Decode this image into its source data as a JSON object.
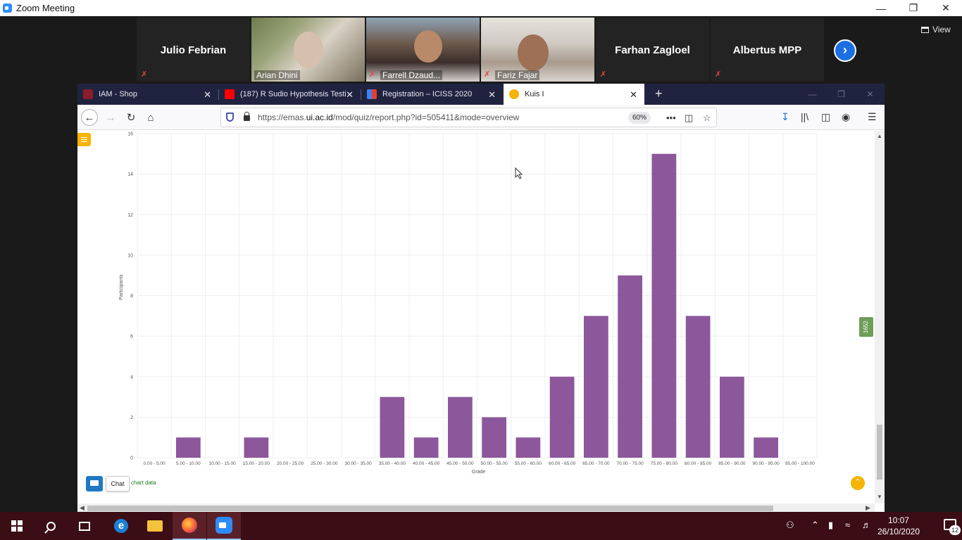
{
  "zoom": {
    "window_title": "Zoom Meeting",
    "view_label": "View",
    "participants": [
      {
        "name": "Julio Febrian",
        "video": false
      },
      {
        "name": "Arian Dhini",
        "video": true
      },
      {
        "name": "Farrell Dzaud...",
        "video": true
      },
      {
        "name": "Fariz Fajar",
        "video": true
      },
      {
        "name": "Farhan Zagloel",
        "video": false
      },
      {
        "name": "Albertus MPP",
        "video": false
      }
    ]
  },
  "browser": {
    "tabs": [
      {
        "label": "IAM - Shop",
        "favicon_color": "#8b1c2b",
        "selected": false
      },
      {
        "label": "(187) R Sudio Hypothesis Testir",
        "favicon_color": "#ff0000",
        "selected": false
      },
      {
        "label": "Registration – ICISS 2020",
        "favicon_color": "#3b82f6",
        "selected": false
      },
      {
        "label": "Kuis I",
        "favicon_color": "#f5b400",
        "selected": true
      }
    ],
    "url_prefix": "https://emas.",
    "url_host": "ui.ac.id",
    "url_path": "/mod/quiz/report.php?id=505411&mode=overview",
    "zoom_level": "60%"
  },
  "page": {
    "chat_label": "Chat",
    "chart_link": "chart data",
    "side_tag": "1652"
  },
  "chart_data": {
    "type": "bar",
    "categories": [
      "0.00 - 5.00",
      "5.00 - 10.00",
      "10.00 - 15.00",
      "15.00 - 20.00",
      "20.00 - 25.00",
      "25.00 - 30.00",
      "30.00 - 35.00",
      "35.00 - 40.00",
      "40.00 - 45.00",
      "45.00 - 50.00",
      "50.00 - 55.00",
      "55.00 - 60.00",
      "60.00 - 65.00",
      "65.00 - 70.00",
      "70.00 - 75.00",
      "75.00 - 80.00",
      "80.00 - 85.00",
      "85.00 - 90.00",
      "90.00 - 95.00",
      "95.00 - 100.00"
    ],
    "values": [
      0,
      1,
      0,
      1,
      0,
      0,
      0,
      3,
      1,
      3,
      2,
      1,
      4,
      7,
      9,
      15,
      7,
      4,
      1,
      0
    ],
    "ylim": [
      0,
      16
    ],
    "yticks": [
      "0",
      "2",
      "4",
      "6",
      "8",
      "10",
      "12",
      "14",
      "16"
    ],
    "xlabel": "Grade",
    "ylabel": "Participants",
    "bar_color": "#8c579b",
    "grid": true
  },
  "taskbar": {
    "time": "10:07",
    "date": "26/10/2020",
    "notifications": "12"
  }
}
